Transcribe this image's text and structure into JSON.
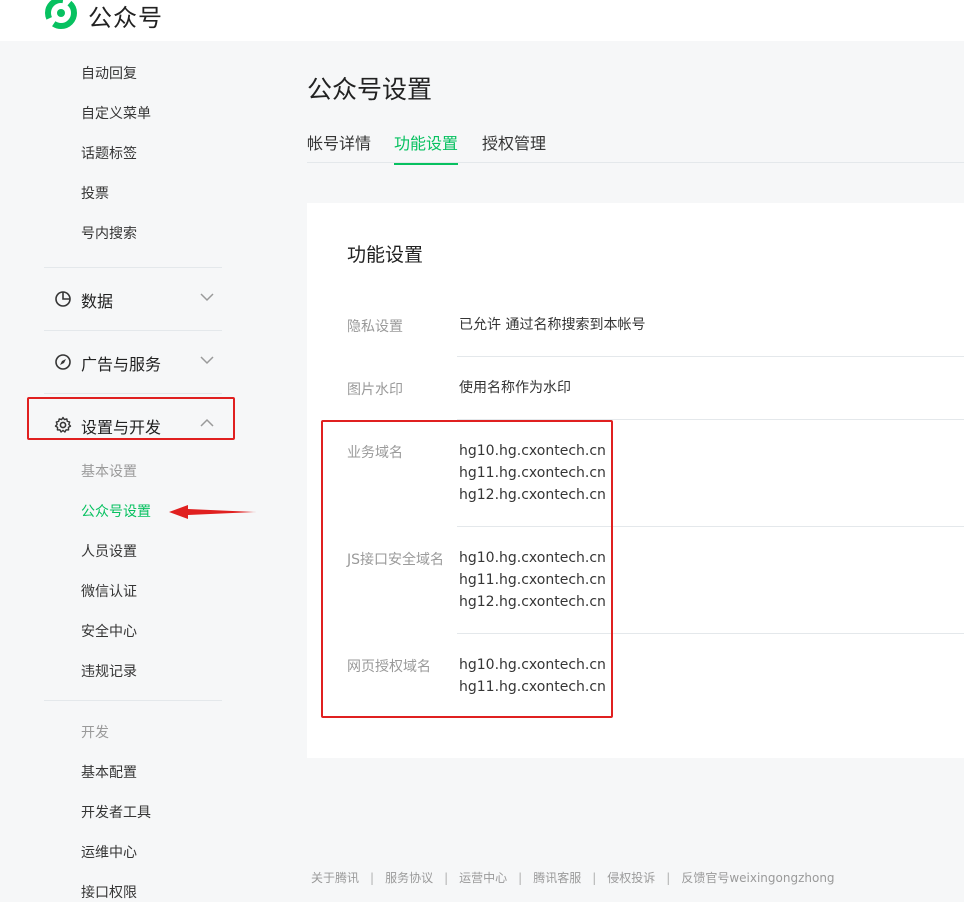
{
  "app": {
    "name": "公众号"
  },
  "sidebar": {
    "items_top": [
      "自动回复",
      "自定义菜单",
      "话题标签",
      "投票",
      "号内搜索"
    ],
    "groups": [
      {
        "label": "数据",
        "icon": "pie-chart-icon",
        "expanded": false
      },
      {
        "label": "广告与服务",
        "icon": "compass-icon",
        "expanded": false
      },
      {
        "label": "设置与开发",
        "icon": "gear-icon",
        "expanded": true
      }
    ],
    "settings_header": "基本设置",
    "settings_items": [
      "公众号设置",
      "人员设置",
      "微信认证",
      "安全中心",
      "违规记录"
    ],
    "active_item": "公众号设置",
    "dev_header": "开发",
    "dev_items": [
      "基本配置",
      "开发者工具",
      "运维中心",
      "接口权限"
    ]
  },
  "main": {
    "title": "公众号设置",
    "tabs": [
      {
        "label": "帐号详情",
        "active": false
      },
      {
        "label": "功能设置",
        "active": true
      },
      {
        "label": "授权管理",
        "active": false
      }
    ]
  },
  "card": {
    "title": "功能设置",
    "rows": [
      {
        "label": "隐私设置",
        "values": [
          "已允许 通过名称搜索到本帐号"
        ]
      },
      {
        "label": "图片水印",
        "values": [
          "使用名称作为水印"
        ]
      },
      {
        "label": "业务域名",
        "values": [
          "hg10.hg.cxontech.cn",
          "hg11.hg.cxontech.cn",
          "hg12.hg.cxontech.cn"
        ]
      },
      {
        "label": "JS接口安全域名",
        "values": [
          "hg10.hg.cxontech.cn",
          "hg11.hg.cxontech.cn",
          "hg12.hg.cxontech.cn"
        ]
      },
      {
        "label": "网页授权域名",
        "values": [
          "hg10.hg.cxontech.cn",
          "hg11.hg.cxontech.cn"
        ]
      }
    ]
  },
  "footer": {
    "links": [
      "关于腾讯",
      "服务协议",
      "运营中心",
      "腾讯客服",
      "侵权投诉",
      "反馈官号weixingongzhong"
    ]
  },
  "colors": {
    "accent": "#07c160",
    "annotation": "#e02020"
  }
}
